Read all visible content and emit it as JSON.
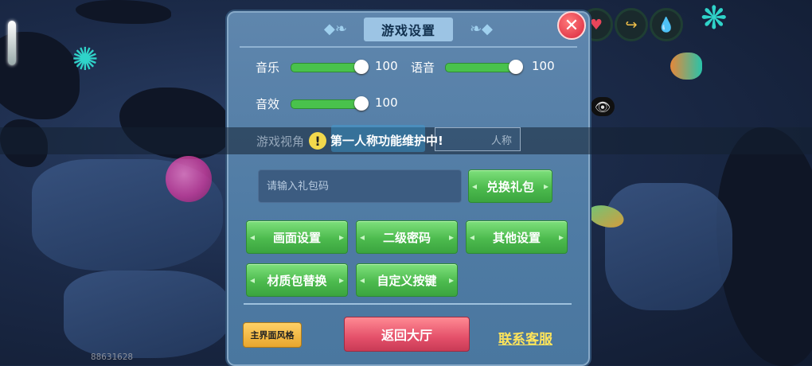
{
  "panel": {
    "title": "游戏设置",
    "close_label": "✕"
  },
  "audio": {
    "music": {
      "label": "音乐",
      "value": "100",
      "level": 1.0
    },
    "voice": {
      "label": "语音",
      "value": "100",
      "level": 1.0
    },
    "sfx": {
      "label": "音效",
      "value": "100",
      "level": 1.0
    }
  },
  "view": {
    "label": "游戏视角",
    "third_person_label": "人称"
  },
  "toast": {
    "icon": "!",
    "message": "第一人称功能维护中!"
  },
  "gift": {
    "placeholder": "请输入礼包码",
    "redeem_label": "兑换礼包"
  },
  "buttons": {
    "graphics": "画面设置",
    "secondary_password": "二级密码",
    "other": "其他设置",
    "texture_pack": "材质包替换",
    "custom_keys": "自定义按键"
  },
  "footer": {
    "ui_style": "主界面风格",
    "back_to_lobby": "返回大厅",
    "contact": "联系客服"
  },
  "hud": {
    "player_id": "88631628",
    "icons": [
      "heart-icon",
      "arrow-icon",
      "water-drop-icon",
      "eye-icon"
    ]
  },
  "colors": {
    "panel_bg": "#5683ad",
    "accent_green": "#4dbb4e",
    "danger_red": "#e4506a",
    "link_yellow": "#ffe45a"
  }
}
